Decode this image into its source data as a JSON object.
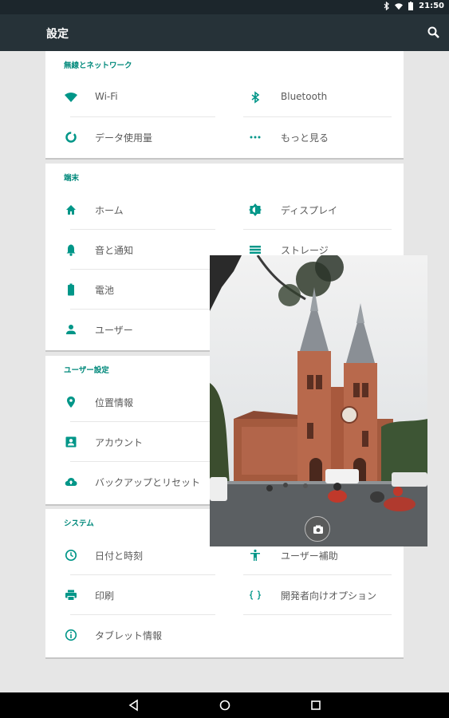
{
  "status_bar": {
    "time": "21:50",
    "icons": [
      "bluetooth-icon",
      "wifi-icon",
      "battery-icon"
    ]
  },
  "toolbar": {
    "title": "設定",
    "search_icon": "search-icon"
  },
  "sections": {
    "wireless": {
      "header": "無線とネットワーク",
      "items": [
        {
          "label": "Wi-Fi",
          "icon": "wifi-icon"
        },
        {
          "label": "Bluetooth",
          "icon": "bluetooth-icon"
        },
        {
          "label": "データ使用量",
          "icon": "data-usage-icon"
        },
        {
          "label": "もっと見る",
          "icon": "more-icon"
        }
      ]
    },
    "device": {
      "header": "端末",
      "items": [
        {
          "label": "ホーム",
          "icon": "home-icon"
        },
        {
          "label": "ディスプレイ",
          "icon": "display-icon"
        },
        {
          "label": "音と通知",
          "icon": "bell-icon"
        },
        {
          "label": "ストレージ",
          "icon": "storage-icon"
        },
        {
          "label": "電池",
          "icon": "battery-icon"
        },
        {
          "label": "ユーザー",
          "icon": "user-icon"
        }
      ]
    },
    "personal": {
      "header": "ユーザー設定",
      "items": [
        {
          "label": "位置情報",
          "icon": "location-icon"
        },
        {
          "label": "アカウント",
          "icon": "account-icon"
        },
        {
          "label": "バックアップとリセット",
          "icon": "backup-icon"
        }
      ]
    },
    "system": {
      "header": "システム",
      "items": [
        {
          "label": "日付と時刻",
          "icon": "clock-icon"
        },
        {
          "label": "ユーザー補助",
          "icon": "accessibility-icon"
        },
        {
          "label": "印刷",
          "icon": "print-icon"
        },
        {
          "label": "開発者向けオプション",
          "icon": "developer-icon"
        },
        {
          "label": "タブレット情報",
          "icon": "info-icon"
        }
      ]
    }
  },
  "colors": {
    "accent": "#009688",
    "toolbar": "#263238",
    "statusbar": "#1c262c",
    "background": "#e6e6e6"
  },
  "nav_bar": {
    "icons": [
      "back-icon",
      "home-circle-icon",
      "recents-icon"
    ]
  }
}
